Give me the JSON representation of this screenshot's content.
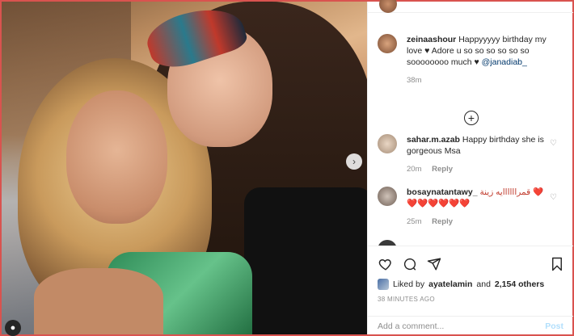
{
  "post": {
    "photo_alt": "",
    "caption": {
      "username": "zeinaashour",
      "text": "Happyyyyy birthday my love ♥ Adore u so so so so so so soooooooo much ♥",
      "mention": "@janadiab_",
      "age": "38m"
    },
    "comments": [
      {
        "username": "sahar.m.azab",
        "text": "Happy birthday she is gorgeous Msa",
        "age": "20m",
        "reply_label": "Reply"
      },
      {
        "username": "bosaynatantawy_",
        "text": "قمراااااايه زينة ❤️ ❤️❤️❤️❤️❤️❤️",
        "age": "25m",
        "reply_label": "Reply"
      }
    ],
    "likes": {
      "prefix": "Liked by",
      "user": "ayatelamin",
      "conj": "and",
      "count": "2,154 others"
    },
    "timestamp": "38 MINUTES AGO",
    "add_comment": {
      "placeholder": "Add a comment...",
      "post_label": "Post"
    }
  },
  "icons": {
    "heart": "heart-icon",
    "comment": "comment-icon",
    "share": "share-icon",
    "save": "bookmark-icon",
    "load_more": "plus-circle-icon",
    "next": "chevron-right-icon"
  }
}
